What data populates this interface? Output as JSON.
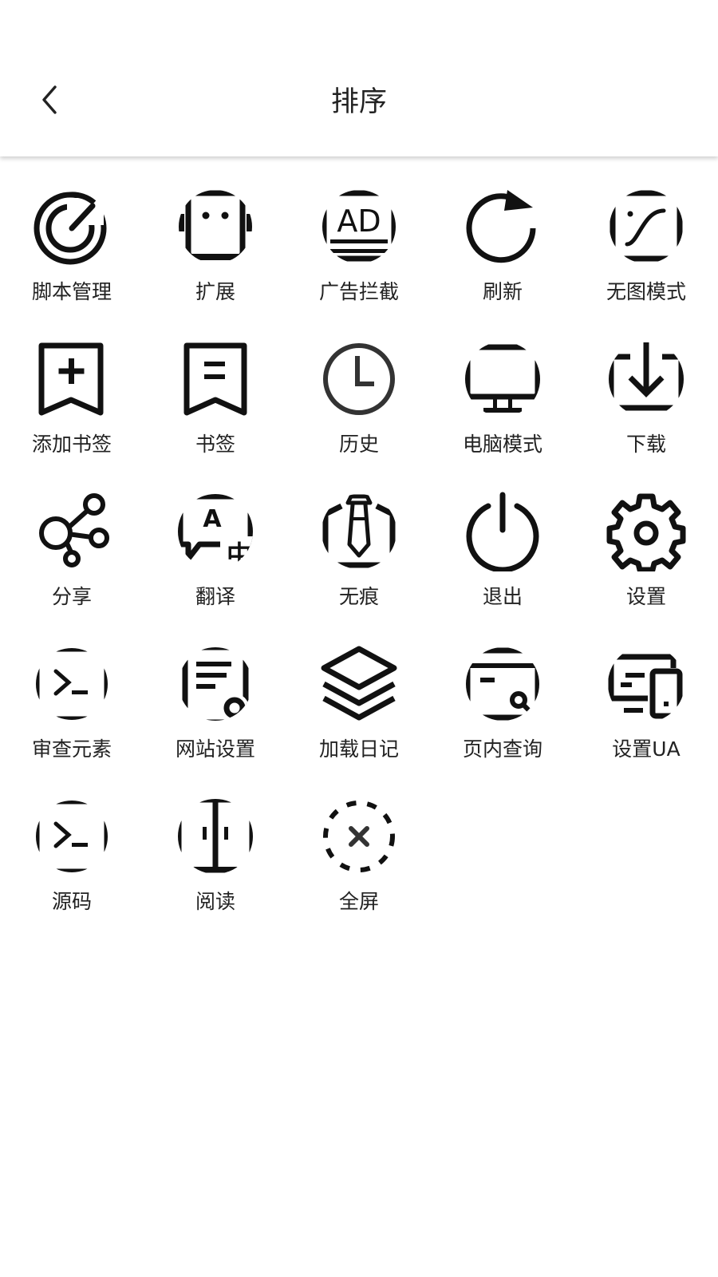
{
  "header": {
    "title": "排序",
    "back_icon": "chevron-left-icon"
  },
  "grid": {
    "items": [
      {
        "label": "脚本管理",
        "icon": "script-radar-icon"
      },
      {
        "label": "扩展",
        "icon": "extension-robot-icon"
      },
      {
        "label": "广告拦截",
        "icon": "ad-block-icon"
      },
      {
        "label": "刷新",
        "icon": "refresh-icon"
      },
      {
        "label": "无图模式",
        "icon": "no-image-mode-icon"
      },
      {
        "label": "添加书签",
        "icon": "add-bookmark-icon"
      },
      {
        "label": "书签",
        "icon": "bookmark-icon"
      },
      {
        "label": "历史",
        "icon": "history-clock-icon"
      },
      {
        "label": "电脑模式",
        "icon": "desktop-mode-icon"
      },
      {
        "label": "下载",
        "icon": "download-icon"
      },
      {
        "label": "分享",
        "icon": "share-icon"
      },
      {
        "label": "翻译",
        "icon": "translate-icon"
      },
      {
        "label": "无痕",
        "icon": "incognito-icon"
      },
      {
        "label": "退出",
        "icon": "power-icon"
      },
      {
        "label": "设置",
        "icon": "gear-icon"
      },
      {
        "label": "审查元素",
        "icon": "terminal-icon"
      },
      {
        "label": "网站设置",
        "icon": "site-settings-icon"
      },
      {
        "label": "加载日记",
        "icon": "layers-icon"
      },
      {
        "label": "页内查询",
        "icon": "find-in-page-icon"
      },
      {
        "label": "设置UA",
        "icon": "devices-icon"
      },
      {
        "label": "源码",
        "icon": "source-code-icon"
      },
      {
        "label": "阅读",
        "icon": "reader-mode-icon"
      },
      {
        "label": "全屏",
        "icon": "fullscreen-icon"
      }
    ]
  }
}
